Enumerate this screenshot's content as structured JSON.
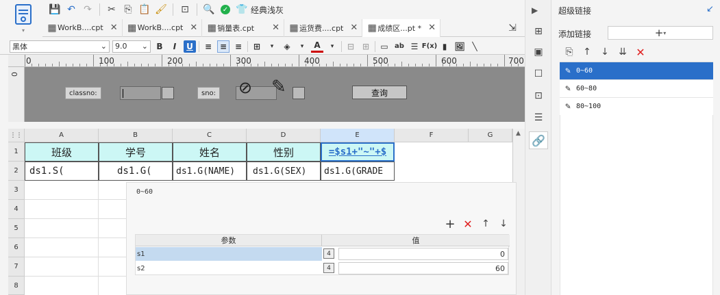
{
  "toolbar": {
    "theme_label": "经典浅灰"
  },
  "tabs": [
    {
      "label": "WorkB....cpt"
    },
    {
      "label": "WorkB....cpt"
    },
    {
      "label": "销量表.cpt"
    },
    {
      "label": "运货费....cpt"
    },
    {
      "label": "成绩区...pt *"
    }
  ],
  "format": {
    "font_name": "黑体",
    "font_size": "9.0"
  },
  "ruler": {
    "marks": [
      "0",
      "100",
      "200",
      "300",
      "400",
      "500",
      "600",
      "700"
    ],
    "vmark": "0"
  },
  "params": {
    "classno_label": "classno:",
    "sno_label": "sno:",
    "query_button": "查询"
  },
  "grid": {
    "columns": [
      "A",
      "B",
      "C",
      "D",
      "E",
      "F",
      "G"
    ],
    "rows": [
      "1",
      "2",
      "3",
      "4",
      "5",
      "6",
      "7",
      "8"
    ],
    "header_cells": [
      "班级",
      "学号",
      "姓名",
      "性别",
      "=$s1+\"~\"+$"
    ],
    "data_cells": [
      "ds1.S(",
      "ds1.G(",
      "ds1.G(NAME)",
      "ds1.G(SEX)",
      "ds1.G(GRADE"
    ]
  },
  "popup": {
    "title": "0~60",
    "col_param": "参数",
    "col_value": "值",
    "rows": [
      {
        "param": "s1",
        "type": "4",
        "value": "0"
      },
      {
        "param": "s2",
        "type": "4",
        "value": "60"
      }
    ]
  },
  "right_panel": {
    "title": "超级链接",
    "add_label": "添加链接",
    "links": [
      {
        "label": "0~60"
      },
      {
        "label": "60~80"
      },
      {
        "label": "80~100"
      }
    ]
  },
  "colors": {
    "accent": "#2a6fc9",
    "header_cell_bg": "#ccf7f5",
    "param_pane_bg": "#8a8a8a"
  }
}
